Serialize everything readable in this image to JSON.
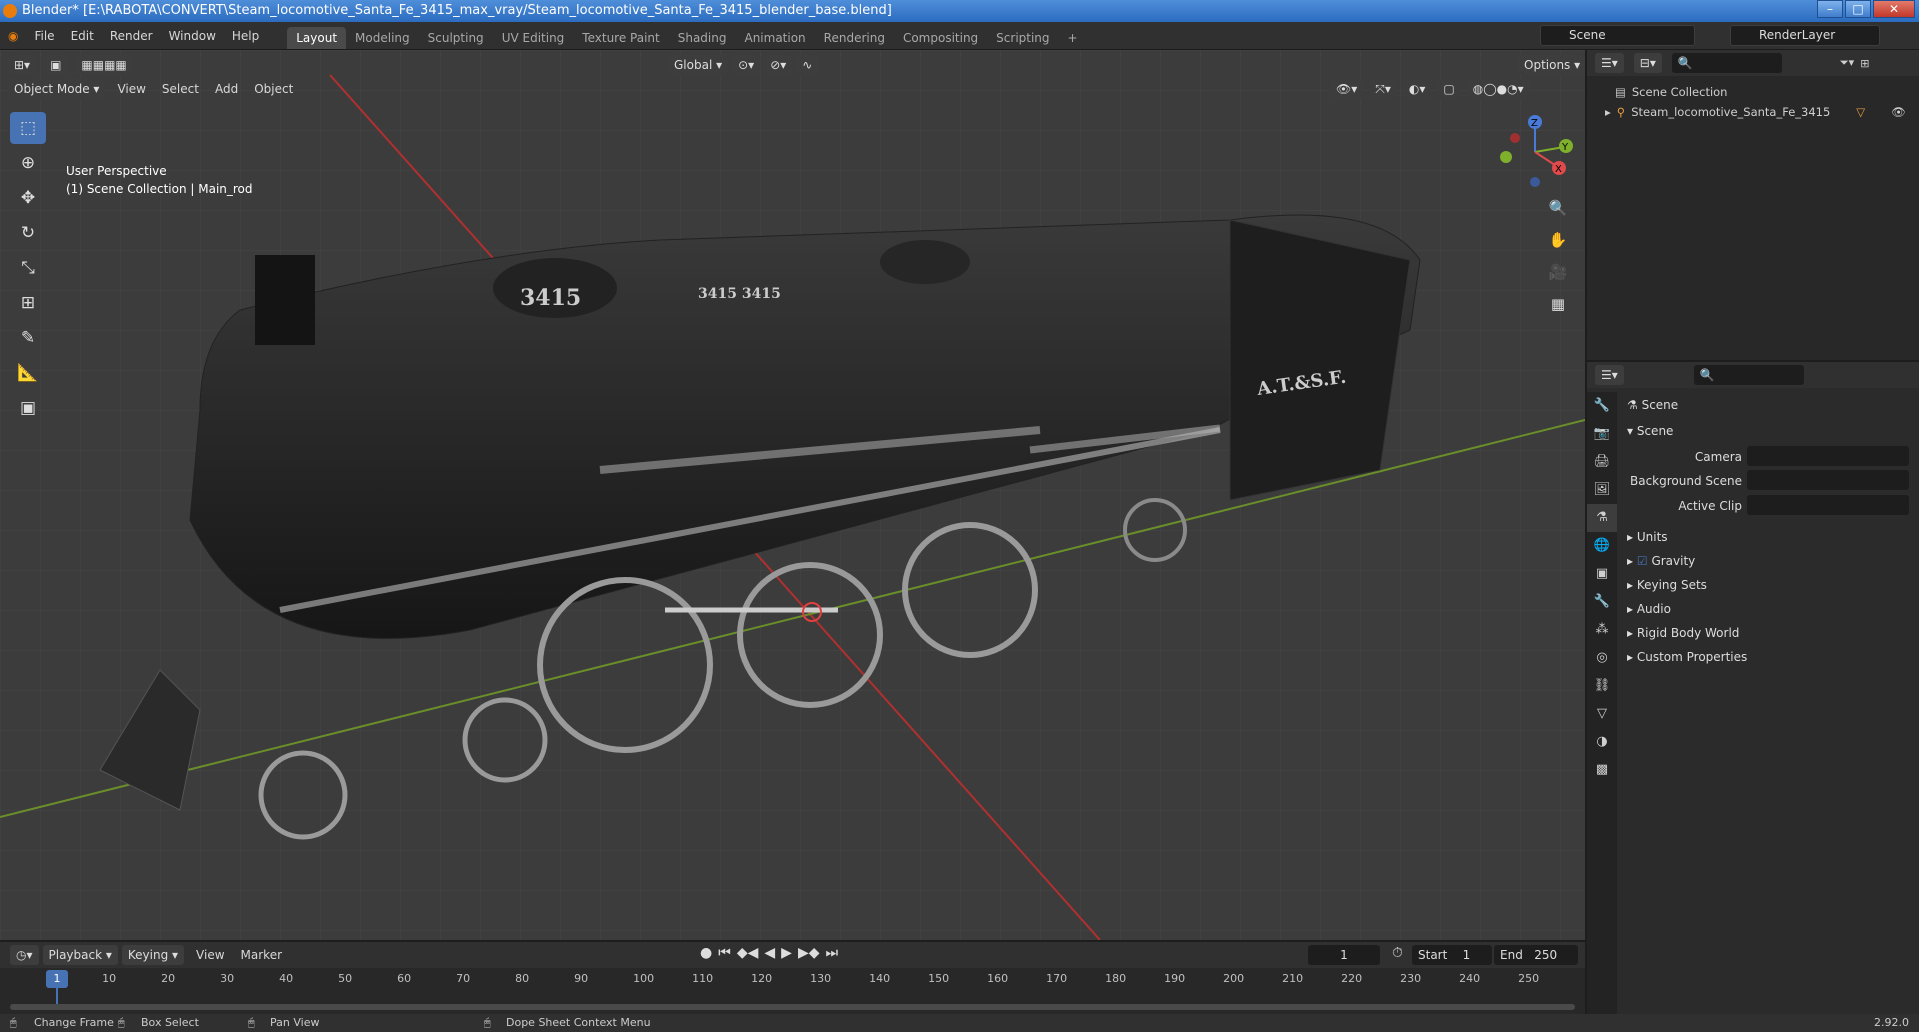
{
  "window": {
    "title": "Blender* [E:\\RABOTA\\CONVERT\\Steam_locomotive_Santa_Fe_3415_max_vray/Steam_locomotive_Santa_Fe_3415_blender_base.blend]"
  },
  "menu": [
    "File",
    "Edit",
    "Render",
    "Window",
    "Help"
  ],
  "workspaces": [
    "Layout",
    "Modeling",
    "Sculpting",
    "UV Editing",
    "Texture Paint",
    "Shading",
    "Animation",
    "Rendering",
    "Compositing",
    "Scripting"
  ],
  "scene_name": "Scene",
  "view_layer": "RenderLayer",
  "header": {
    "mode": "Object Mode",
    "view": "View",
    "select": "Select",
    "add": "Add",
    "object": "Object",
    "transform": "Global",
    "options": "Options"
  },
  "viewport": {
    "perspective": "User Perspective",
    "collection": "(1) Scene Collection | Main_rod",
    "model_numbers": [
      "3415",
      "3415 3415"
    ],
    "model_text": "A.T.&S.F."
  },
  "gizmo": {
    "z": "Z",
    "y": "Y",
    "x": "X"
  },
  "outliner": {
    "root": "Scene Collection",
    "item": "Steam_locomotive_Santa_Fe_3415"
  },
  "properties": {
    "title": "Scene",
    "section": "Scene",
    "camera_label": "Camera",
    "bg_label": "Background Scene",
    "clip_label": "Active Clip",
    "panels": [
      "Units",
      "Gravity",
      "Keying Sets",
      "Audio",
      "Rigid Body World",
      "Custom Properties"
    ]
  },
  "timeline": {
    "playback": "Playback",
    "keying": "Keying",
    "view": "View",
    "marker": "Marker",
    "current": "1",
    "start_label": "Start",
    "start": "1",
    "end_label": "End",
    "end": "250",
    "ticks": [
      "1",
      "10",
      "20",
      "30",
      "40",
      "50",
      "60",
      "70",
      "80",
      "90",
      "100",
      "110",
      "120",
      "130",
      "140",
      "150",
      "160",
      "170",
      "180",
      "190",
      "200",
      "210",
      "220",
      "230",
      "240",
      "250"
    ]
  },
  "status": {
    "change_frame": "Change Frame",
    "box_select": "Box Select",
    "pan_view": "Pan View",
    "context_menu": "Dope Sheet Context Menu",
    "version": "2.92.0"
  }
}
